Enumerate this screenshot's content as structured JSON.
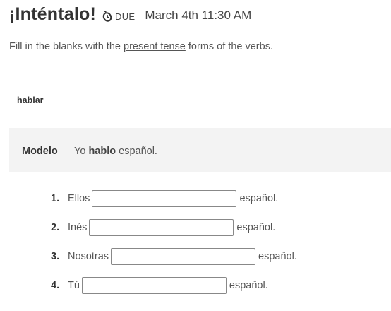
{
  "header": {
    "title": "¡Inténtalo!",
    "due_label": "DUE",
    "due_date": "March 4th 11:30 AM"
  },
  "instructions": {
    "before": "Fill in the blanks with the ",
    "underlined": "present tense",
    "after": " forms of the verbs."
  },
  "verb": "hablar",
  "model": {
    "label": "Modelo",
    "subject": "Yo",
    "answer": "hablo",
    "rest": "español."
  },
  "items": [
    {
      "number": "1.",
      "subject": "Ellos",
      "value": "",
      "ending": "español."
    },
    {
      "number": "2.",
      "subject": "Inés",
      "value": "",
      "ending": "español."
    },
    {
      "number": "3.",
      "subject": "Nosotras",
      "value": "",
      "ending": "español."
    },
    {
      "number": "4.",
      "subject": "Tú",
      "value": "",
      "ending": "español."
    }
  ]
}
